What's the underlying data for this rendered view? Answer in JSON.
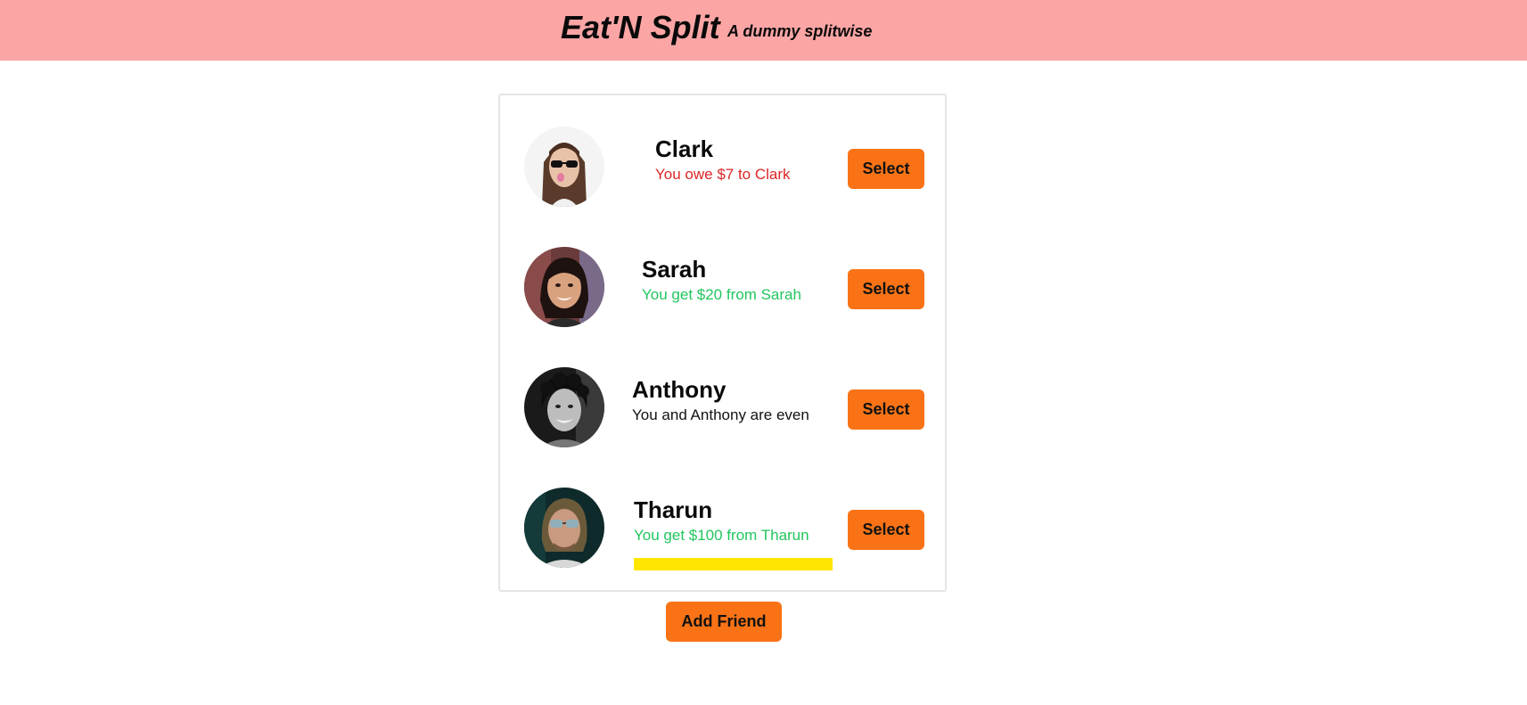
{
  "header": {
    "title": "Eat'N Split",
    "subtitle": "A dummy splitwise",
    "background": "#fca5a5"
  },
  "friends": [
    {
      "name": "Clark",
      "status": "You owe $7 to Clark",
      "status_kind": "owe",
      "select_label": "Select",
      "avatar_icon": "avatar-photo"
    },
    {
      "name": "Sarah",
      "status": "You get $20 from Sarah",
      "status_kind": "get",
      "select_label": "Select",
      "avatar_icon": "avatar-photo"
    },
    {
      "name": "Anthony",
      "status": "You and Anthony are even",
      "status_kind": "even",
      "select_label": "Select",
      "avatar_icon": "avatar-photo"
    },
    {
      "name": "Tharun",
      "status": "You get $100 from Tharun",
      "status_kind": "get",
      "select_label": "Select",
      "avatar_icon": "avatar-photo"
    }
  ],
  "add_friend_label": "Add Friend",
  "colors": {
    "accent": "#f97316",
    "owe": "#dc2626",
    "get": "#22c55e",
    "highlight": "#ffe600"
  }
}
